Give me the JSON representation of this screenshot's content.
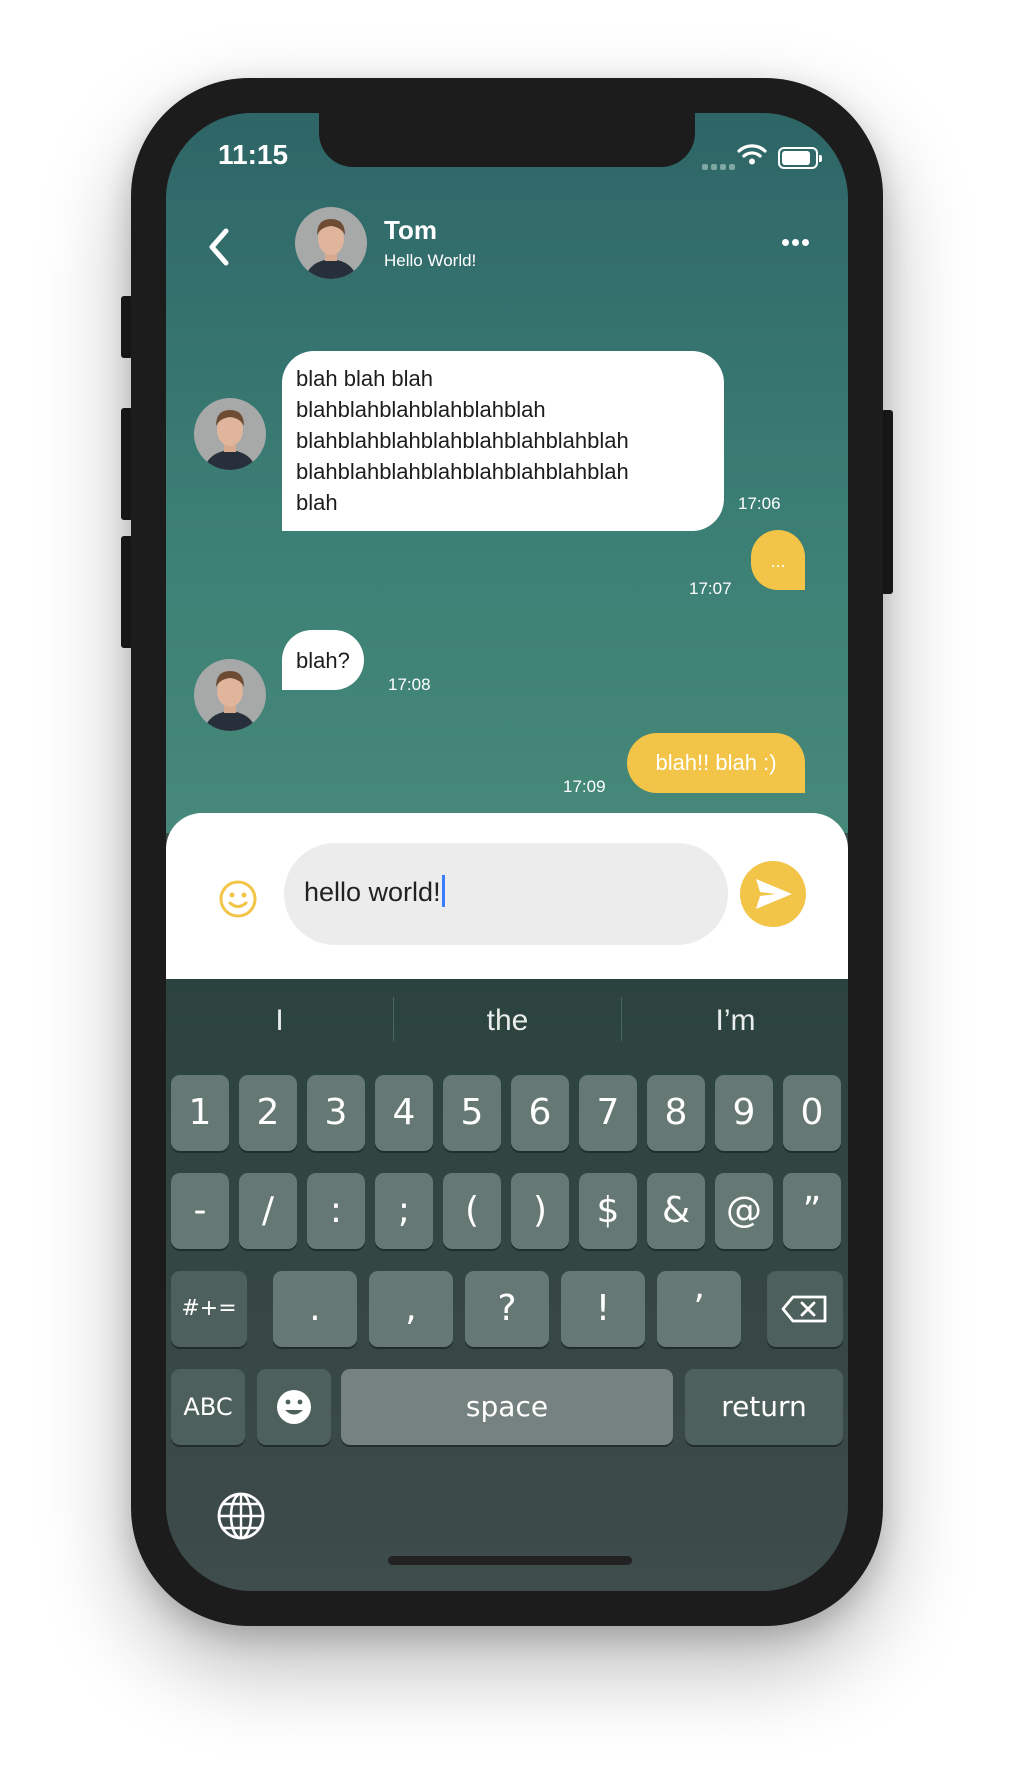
{
  "status": {
    "time": "11:15"
  },
  "header": {
    "name": "Tom",
    "status": "Hello World!"
  },
  "messages": [
    {
      "dir": "in",
      "lines": [
        "blah blah blah",
        "blahblahblahblahblahblah",
        "blahblahblahblahblahblahblahblah",
        "blahblahblahblahblahblahblahblah",
        "blah"
      ],
      "time": "17:06"
    },
    {
      "dir": "out",
      "text": "...",
      "time": "17:07"
    },
    {
      "dir": "in",
      "text": "blah?",
      "time": "17:08"
    },
    {
      "dir": "out",
      "text": "blah!! blah :)",
      "time": "17:09"
    }
  ],
  "composer": {
    "value": "hello world!"
  },
  "keyboard": {
    "suggestions": [
      "I",
      "the",
      "I’m"
    ],
    "row1": [
      "1",
      "2",
      "3",
      "4",
      "5",
      "6",
      "7",
      "8",
      "9",
      "0"
    ],
    "row2": [
      "-",
      "/",
      ":",
      ";",
      "(",
      ")",
      "$",
      "&",
      "@",
      "”"
    ],
    "row3": [
      ".",
      ",",
      "?",
      "!",
      "’"
    ],
    "mode_key": "#+=",
    "abc_key": "ABC",
    "space": "space",
    "return": "return"
  },
  "colors": {
    "accent": "#f2c447",
    "chat_top": "#2e6567",
    "chat_bottom": "#46897a",
    "keyboard": "#334541"
  },
  "icons": [
    "back-icon",
    "more-icon",
    "emoji-icon",
    "send-icon",
    "backspace-icon",
    "globe-icon"
  ]
}
